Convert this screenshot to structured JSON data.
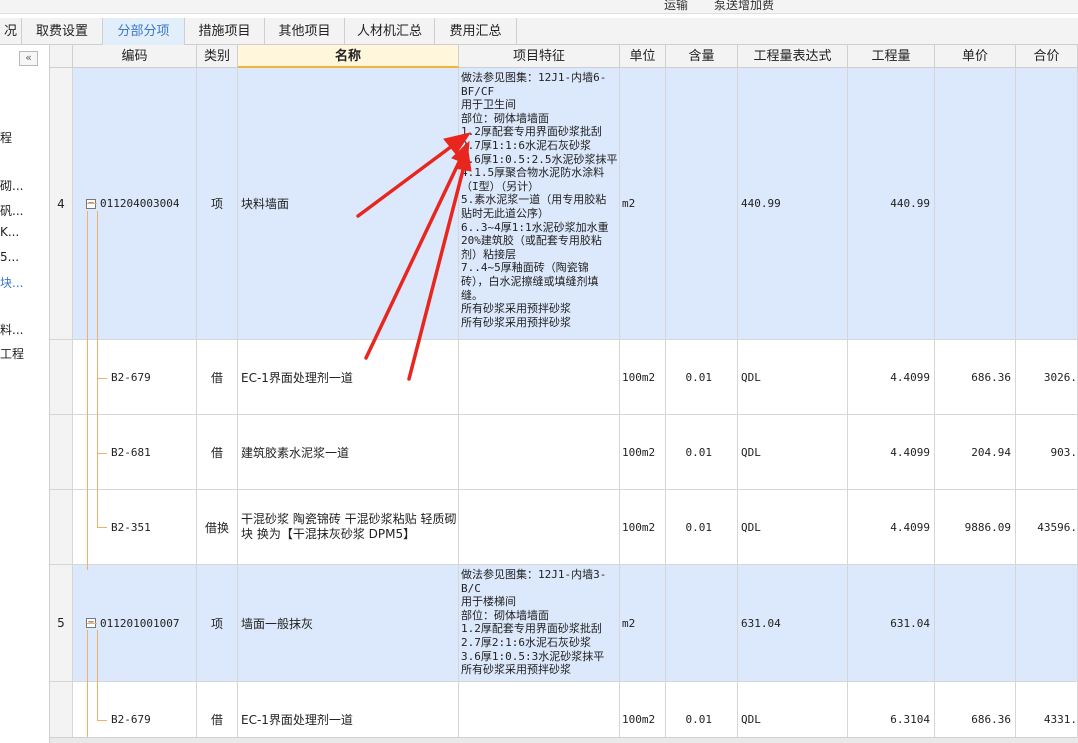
{
  "top_strip": [
    "运输",
    "泵送增加费"
  ],
  "tabs": [
    {
      "label": "况"
    },
    {
      "label": "取费设置"
    },
    {
      "label": "分部分项"
    },
    {
      "label": "措施项目"
    },
    {
      "label": "其他项目"
    },
    {
      "label": "人材机汇总"
    },
    {
      "label": "费用汇总"
    }
  ],
  "sidebar": {
    "collapse_glyph": "«",
    "items": [
      "程",
      "砌...",
      "矾...",
      "K...",
      "5...",
      "块...",
      "料...",
      "工程"
    ]
  },
  "columns": {
    "code": "编码",
    "type": "类别",
    "name": "名称",
    "feature": "项目特征",
    "unit": "单位",
    "content": "含量",
    "expr": "工程量表达式",
    "qty": "工程量",
    "price": "单价",
    "total": "合价"
  },
  "rows": [
    {
      "num": "4",
      "code": "011204003004",
      "type": "项",
      "name": "块料墙面",
      "feature": [
        "做法参见图集：12J1-内墙6-",
        "BF/CF",
        "用于卫生间",
        "部位：砌体墙墙面",
        "1.2厚配套专用界面砂浆批刮",
        "2.7厚1:1:6水泥石灰砂浆",
        "3.6厚1:0.5:2.5水泥砂浆抹平",
        "4.1.5厚聚合物水泥防水涂料",
        "（I型）（另计）",
        "5.素水泥浆一道（用专用胶粘",
        "贴时无此道公序）",
        "6..3~4厚1:1水泥砂浆加水重",
        "20%建筑胶（或配套专用胶粘",
        "剂）粘接层",
        "7..4~5厚釉面砖（陶瓷锦",
        "砖），白水泥擦缝或填缝剂填",
        "缝。",
        "所有砂浆采用预拌砂浆",
        "所有砂浆采用预拌砂浆"
      ],
      "unit": "m2",
      "content": "",
      "expr": "440.99",
      "qty": "440.99",
      "price": "",
      "total": ""
    },
    {
      "num": "",
      "code": "B2-679",
      "type": "借",
      "name": "EC-1界面处理剂一道",
      "feature": [],
      "unit": "100m2",
      "content": "0.01",
      "expr": "QDL",
      "qty": "4.4099",
      "price": "686.36",
      "total": "3026."
    },
    {
      "num": "",
      "code": "B2-681",
      "type": "借",
      "name": "建筑胶素水泥浆一道",
      "feature": [],
      "unit": "100m2",
      "content": "0.01",
      "expr": "QDL",
      "qty": "4.4099",
      "price": "204.94",
      "total": "903."
    },
    {
      "num": "",
      "code": "B2-351",
      "type": "借换",
      "name": "干混砂浆 陶瓷锦砖 干混砂浆粘贴 轻质砌块  换为【干混抹灰砂浆 DPM5】",
      "feature": [],
      "unit": "100m2",
      "content": "0.01",
      "expr": "QDL",
      "qty": "4.4099",
      "price": "9886.09",
      "total": "43596."
    },
    {
      "num": "5",
      "code": "011201001007",
      "type": "项",
      "name": "墙面一般抹灰",
      "feature": [
        "做法参见图集：12J1-内墙3-",
        "B/C",
        "用于楼梯间",
        "部位：砌体墙墙面",
        "1.2厚配套专用界面砂浆批刮",
        "2.7厚2:1:6水泥石灰砂浆",
        "3.6厚1:0.5:3水泥砂浆抹平",
        "所有砂浆采用预拌砂浆"
      ],
      "unit": "m2",
      "content": "",
      "expr": "631.04",
      "qty": "631.04",
      "price": "",
      "total": ""
    },
    {
      "num": "",
      "code": "B2-679",
      "type": "借",
      "name": "EC-1界面处理剂一道",
      "feature": [],
      "unit": "100m2",
      "content": "0.01",
      "expr": "QDL",
      "qty": "6.3104",
      "price": "686.36",
      "total": "4331."
    }
  ],
  "colors": {
    "main_row_bg": "#dce8fb",
    "active_tab_text": "#3a78c9",
    "annotation_arrow": "#e8261e",
    "tree_line": "#f0b068"
  }
}
